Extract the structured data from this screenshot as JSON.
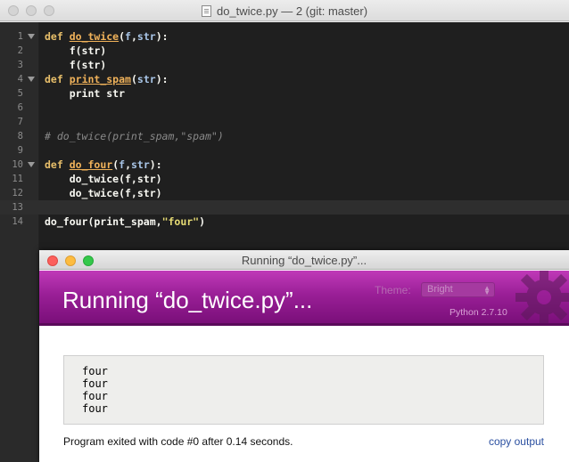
{
  "window": {
    "title": "do_twice.py — 2 (git: master)"
  },
  "editor": {
    "current_line": 13,
    "lines": [
      {
        "n": "1"
      },
      {
        "n": "2"
      },
      {
        "n": "3"
      },
      {
        "n": "4"
      },
      {
        "n": "5"
      },
      {
        "n": "6"
      },
      {
        "n": "7"
      },
      {
        "n": "8"
      },
      {
        "n": "9"
      },
      {
        "n": "10"
      },
      {
        "n": "11"
      },
      {
        "n": "12"
      },
      {
        "n": "13"
      },
      {
        "n": "14"
      }
    ],
    "code": {
      "l1_kw": "def",
      "l1_fn": "do_twice",
      "l1_rest_open": "(",
      "l1_p1": "f",
      "l1_comma": ",",
      "l1_p2": "str",
      "l1_close": "):",
      "l2": "    f(str)",
      "l3": "    f(str)",
      "l4_kw": "def",
      "l4_fn": "print_spam",
      "l4_open": "(",
      "l4_p1": "str",
      "l4_close": "):",
      "l5": "    print str",
      "l8": "# do_twice(print_spam,\"spam\")",
      "l10_kw": "def",
      "l10_fn": "do_four",
      "l10_open": "(",
      "l10_p1": "f",
      "l10_comma": ",",
      "l10_p2": "str",
      "l10_close": "):",
      "l11": "    do_twice(f,str)",
      "l12": "    do_twice(f,str)",
      "l14_call": "do_four(print_spam,",
      "l14_str": "\"four\"",
      "l14_close": ")"
    }
  },
  "run_window": {
    "titlebar": "Running “do_twice.py”...",
    "banner_title": "Running “do_twice.py”...",
    "theme_label": "Theme:",
    "theme_value": "Bright",
    "python_version": "Python 2.7.10",
    "output_lines": [
      "four",
      "four",
      "four",
      "four"
    ],
    "exit_message": "Program exited with code #0 after 0.14 seconds.",
    "copy_output": "copy output",
    "accent_color": "#9a1f97"
  }
}
